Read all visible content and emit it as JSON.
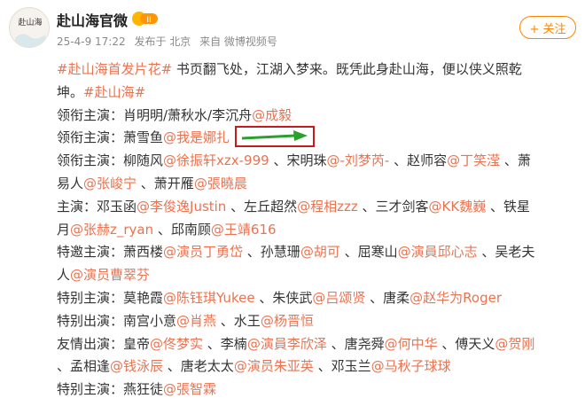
{
  "post": {
    "author": "赴山海官微",
    "vip_badge": "II",
    "date": "25-4-9 17:22",
    "posted_from": "发布于 北京",
    "source": "来自 微博视频号",
    "follow_label": "+ 关注"
  },
  "avatar": {
    "text": "赴山海"
  },
  "content": {
    "line1": [
      {
        "t": "#赴山海首发片花#",
        "c": "tag"
      },
      {
        "t": " 书页翻飞处，江湖入梦来。既凭此身赴山海，便以侠义照乾",
        "c": "text"
      }
    ],
    "line2": [
      {
        "t": "坤。",
        "c": "text"
      },
      {
        "t": "#赴山海#",
        "c": "tag"
      }
    ],
    "line3": [
      {
        "t": "领衔主演：肖明明/萧秋水/李沉舟",
        "c": "text"
      },
      {
        "t": "@成毅",
        "c": "link"
      }
    ],
    "line4": [
      {
        "t": "领衔主演：萧雪鱼",
        "c": "text"
      },
      {
        "t": "@我是娜扎",
        "c": "link"
      }
    ],
    "line5": [
      {
        "t": "领衔主演：柳随风",
        "c": "text"
      },
      {
        "t": "@徐振轩xzx-999",
        "c": "link"
      },
      {
        "t": " 、宋明珠",
        "c": "text"
      },
      {
        "t": "@-刘梦芮-",
        "c": "link"
      },
      {
        "t": " 、赵师容",
        "c": "text"
      },
      {
        "t": "@丁笑滢",
        "c": "link"
      },
      {
        "t": " 、萧",
        "c": "text"
      }
    ],
    "line6": [
      {
        "t": "易人",
        "c": "text"
      },
      {
        "t": "@张峻宁",
        "c": "link"
      },
      {
        "t": " 、萧开雁",
        "c": "text"
      },
      {
        "t": "@張曉晨",
        "c": "link"
      }
    ],
    "line7": [
      {
        "t": "主演：邓玉函",
        "c": "text"
      },
      {
        "t": "@李俊逸Justin",
        "c": "link"
      },
      {
        "t": " 、左丘超然",
        "c": "text"
      },
      {
        "t": "@程相zzz",
        "c": "link"
      },
      {
        "t": " 、三才剑客",
        "c": "text"
      },
      {
        "t": "@KK魏巍",
        "c": "link"
      },
      {
        "t": " 、铁星",
        "c": "text"
      }
    ],
    "line8": [
      {
        "t": "月",
        "c": "text"
      },
      {
        "t": "@张赫z_ryan",
        "c": "link"
      },
      {
        "t": " 、邱南顾",
        "c": "text"
      },
      {
        "t": "@王靖616",
        "c": "link"
      }
    ],
    "line9": [
      {
        "t": "特邀主演：萧西楼",
        "c": "text"
      },
      {
        "t": "@演员丁勇岱",
        "c": "link"
      },
      {
        "t": " 、孙慧珊",
        "c": "text"
      },
      {
        "t": "@胡可",
        "c": "link"
      },
      {
        "t": " 、屈寒山",
        "c": "text"
      },
      {
        "t": "@演員邱心志",
        "c": "link"
      },
      {
        "t": " 、吴老夫",
        "c": "text"
      }
    ],
    "line10": [
      {
        "t": "人",
        "c": "text"
      },
      {
        "t": "@演员曹翠芬",
        "c": "link"
      }
    ],
    "line11": [
      {
        "t": "特别主演：莫艳霞",
        "c": "text"
      },
      {
        "t": "@陈钰琪Yukee",
        "c": "link"
      },
      {
        "t": " 、朱侠武",
        "c": "text"
      },
      {
        "t": "@吕颂贤",
        "c": "link"
      },
      {
        "t": " 、唐柔",
        "c": "text"
      },
      {
        "t": "@赵华为Roger",
        "c": "link"
      }
    ],
    "line12": [
      {
        "t": "特别出演：南宫小意",
        "c": "text"
      },
      {
        "t": "@肖燕",
        "c": "link"
      },
      {
        "t": " 、水王",
        "c": "text"
      },
      {
        "t": "@杨晋恒",
        "c": "link"
      }
    ],
    "line13": [
      {
        "t": "友情出演：皇帝",
        "c": "text"
      },
      {
        "t": "@佟梦实",
        "c": "link"
      },
      {
        "t": " 、李楠",
        "c": "text"
      },
      {
        "t": "@演員李欣泽",
        "c": "link"
      },
      {
        "t": " 、唐尧舜",
        "c": "text"
      },
      {
        "t": "@何中华",
        "c": "link"
      },
      {
        "t": " 、傅天义",
        "c": "text"
      },
      {
        "t": "@贺刚",
        "c": "link"
      }
    ],
    "line14": [
      {
        "t": "、孟相逢",
        "c": "text"
      },
      {
        "t": "@钱泳辰",
        "c": "link"
      },
      {
        "t": " 、唐老太太",
        "c": "text"
      },
      {
        "t": "@演员朱亚英",
        "c": "link"
      },
      {
        "t": " 、邓玉兰",
        "c": "text"
      },
      {
        "t": "@马秋子球球",
        "c": "link"
      }
    ],
    "line15": [
      {
        "t": "特别主演：燕狂徒",
        "c": "text"
      },
      {
        "t": "@張智霖",
        "c": "link"
      }
    ]
  },
  "colors": {
    "accent": "#eb7350",
    "follow": "#ff8200",
    "arrow": "#2ca02c",
    "highlight_box": "#c51b1b"
  }
}
